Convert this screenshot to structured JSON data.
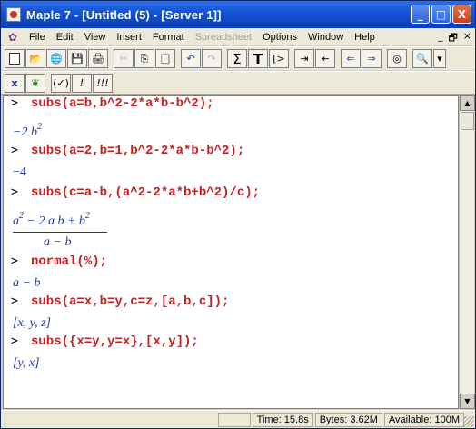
{
  "window": {
    "title": "Maple 7  - [Untitled (5) - [Server 1]]",
    "buttons": {
      "minimize": "_",
      "maximize": "□",
      "close": "X"
    }
  },
  "menu": {
    "items": [
      "File",
      "Edit",
      "View",
      "Insert",
      "Format",
      "Spreadsheet",
      "Options",
      "Window",
      "Help"
    ],
    "mdi_controls": [
      "_",
      "🗗",
      "×"
    ]
  },
  "toolbar1": {
    "buttons": [
      "new-icon",
      "open-icon",
      "open-url-icon",
      "save-icon",
      "print-icon",
      "cut-icon",
      "copy-icon",
      "paste-icon",
      "undo-icon",
      "redo-icon",
      "sigma-icon",
      "text-icon",
      "input-icon",
      "indent-icon",
      "outdent-icon",
      "back-icon",
      "forward-icon",
      "stop-icon",
      "zoom-icon",
      "dropdown-icon"
    ],
    "glyphs": {
      "sigma": "Σ",
      "text": "T",
      "input": "[>",
      "back": "⇐",
      "forward": "⇒"
    }
  },
  "toolbar2": {
    "buttons": [
      "x-icon",
      "maple-leaf-icon",
      "check-syntax-icon",
      "execute-icon",
      "execute-all-icon"
    ],
    "labels": {
      "x": "x",
      "check": "(✓)",
      "execute": "!",
      "execute_all": "!!!"
    }
  },
  "worksheet": {
    "prompt": ">",
    "commands": [
      "subs(a=b,b^2-2*a*b-b^2);",
      "subs(a=2,b=1,b^2-2*a*b-b^2);",
      "subs(c=a-b,(a^2-2*a*b+b^2)/c);",
      "normal(%);",
      "subs(a=x,b=y,c=z,[a,b,c]);",
      "subs({x=y,y=x},[x,y]);"
    ],
    "outputs": {
      "o1_coef": "−2 ",
      "o1_var": "b",
      "o1_exp": "2",
      "o2": "−4",
      "o3_num": "a",
      "o3_exp_a": "2",
      "o3_mid": " − 2 a b + b",
      "o3_exp_b": "2",
      "o3_den": "a − b",
      "o4": "a − b",
      "o5": "[x, y, z]",
      "o6": "[y, x]"
    }
  },
  "status": {
    "time": "Time:  15.8s",
    "bytes": "Bytes:  3.62M",
    "available": "Available:  100M"
  }
}
